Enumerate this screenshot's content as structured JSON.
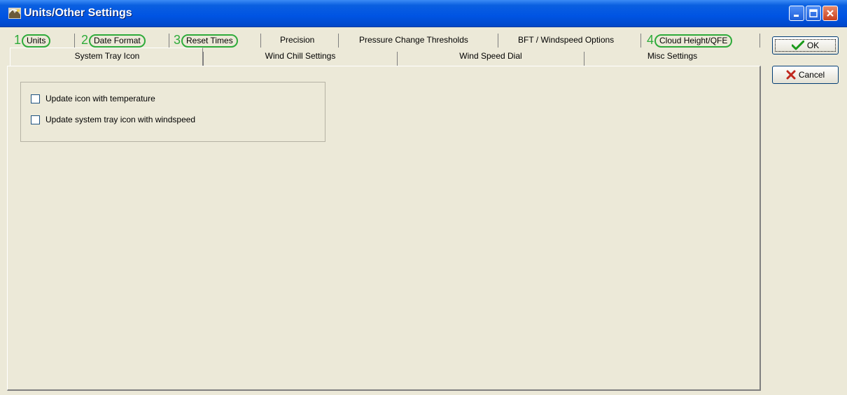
{
  "window": {
    "title": "Units/Other Settings"
  },
  "tabs_row1": [
    {
      "number": "1",
      "label": "Units",
      "annotated": true
    },
    {
      "number": "2",
      "label": "Date Format",
      "annotated": true
    },
    {
      "number": "3",
      "label": "Reset Times",
      "annotated": true
    },
    {
      "number": "",
      "label": "Precision",
      "annotated": false
    },
    {
      "number": "",
      "label": "Pressure Change Thresholds",
      "annotated": false
    },
    {
      "number": "",
      "label": "BFT / Windspeed Options",
      "annotated": false
    },
    {
      "number": "4",
      "label": "Cloud Height/QFE",
      "annotated": true
    }
  ],
  "tabs_row2": [
    {
      "label": "System Tray Icon",
      "active": true
    },
    {
      "label": "Wind Chill Settings",
      "active": false
    },
    {
      "label": "Wind Speed Dial",
      "active": false
    },
    {
      "label": "Misc Settings",
      "active": false
    }
  ],
  "system_tray": {
    "options": [
      {
        "label": "Update icon with temperature",
        "checked": false
      },
      {
        "label": "Update system tray icon with windspeed",
        "checked": false
      }
    ]
  },
  "buttons": {
    "ok_label": "OK",
    "cancel_label": "Cancel"
  },
  "colors": {
    "annotation": "#2eab3a",
    "titlebar": "#0054e3",
    "dialog_bg": "#ece9d8"
  },
  "icons": {
    "app": "weather-station-icon",
    "ok": "checkmark-icon",
    "cancel": "x-mark-icon"
  }
}
